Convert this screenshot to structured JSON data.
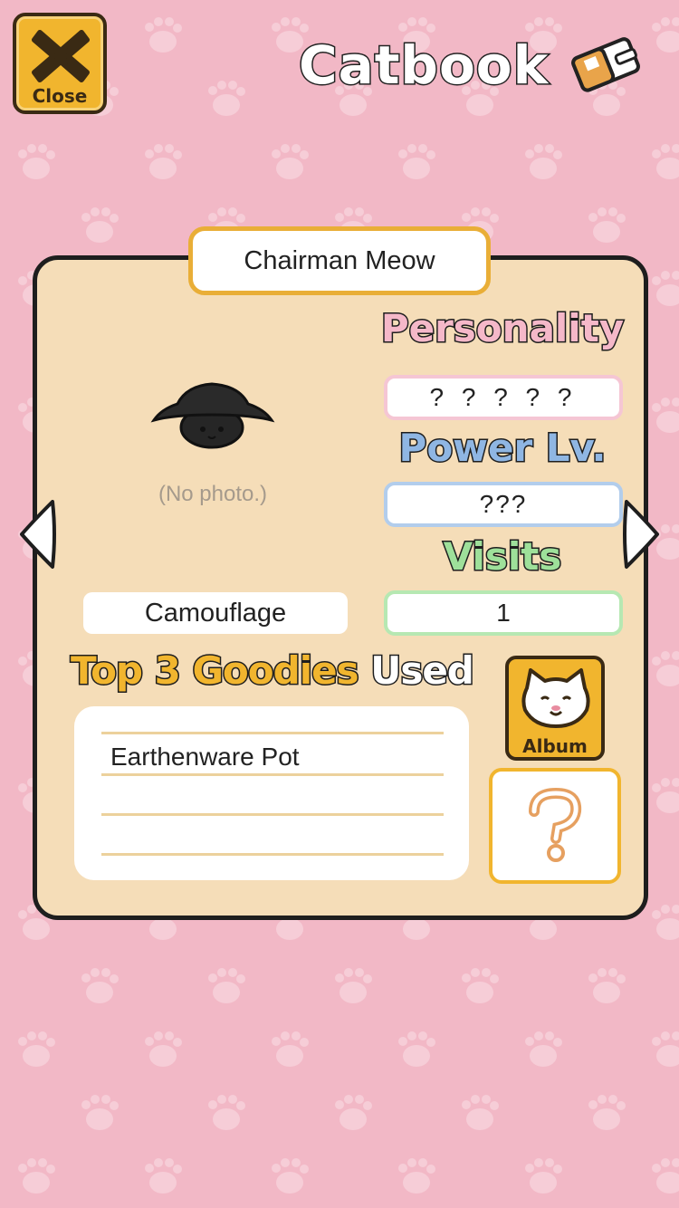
{
  "header": {
    "close_label": "Close",
    "title": "Catbook"
  },
  "cat": {
    "name": "Chairman Meow",
    "photo_status": "(No photo.)",
    "coat": "Camouflage"
  },
  "stats": {
    "personality_heading": "Personality",
    "personality_value": "? ? ? ? ?",
    "power_heading": "Power Lv.",
    "power_value": "???",
    "visits_heading": "Visits",
    "visits_value": "1"
  },
  "goodies": {
    "heading_part1": "Top 3 Goodies",
    "heading_part2": "Used",
    "items": [
      "Earthenware Pot",
      "",
      ""
    ]
  },
  "buttons": {
    "album_label": "Album",
    "mystery_icon": "question-mark-icon"
  },
  "colors": {
    "background": "#f2b8c6",
    "panel": "#f5ddb8",
    "accent_yellow": "#f1b52e",
    "personality": "#f5b8c9",
    "power": "#8fb6e3",
    "visits": "#9ee09a"
  }
}
